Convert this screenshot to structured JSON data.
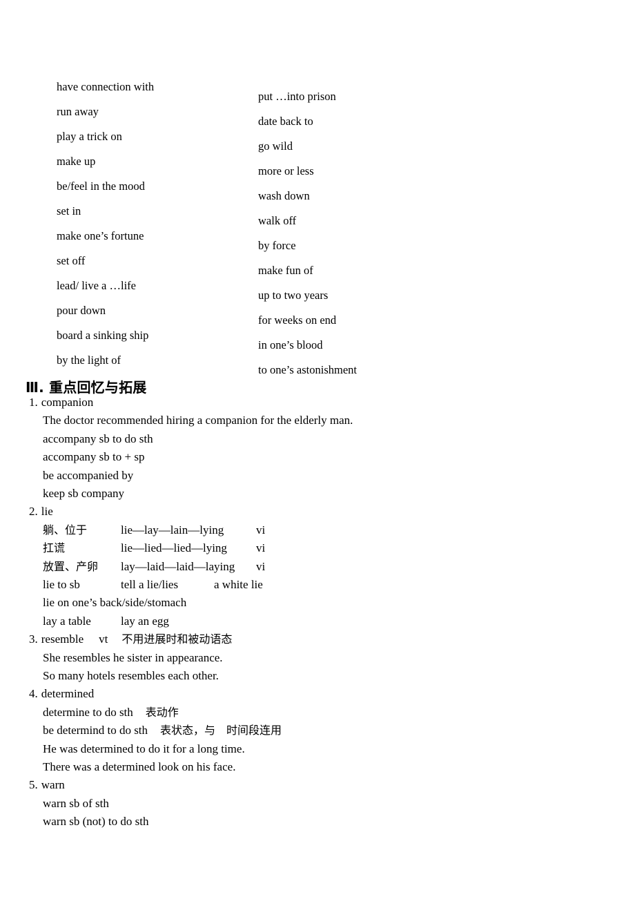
{
  "phrase_list": {
    "left_column": [
      "have connection with",
      "run away",
      "play a trick on",
      "make up",
      "be/feel in the mood",
      "set in",
      "make one’s fortune",
      "set off",
      "lead/ live a …life",
      "pour down",
      "board a sinking ship",
      "by the light of"
    ],
    "right_column": [
      "put …into prison",
      "date back to",
      "go wild",
      "more or less",
      "wash down",
      "walk off",
      "by force",
      "make fun of",
      "up to two years",
      "for weeks on end",
      "in one’s blood",
      "to one’s astonishment"
    ]
  },
  "section": {
    "heading": "Ⅲ. 重点回忆与拓展"
  },
  "entries": [
    {
      "num": "1.",
      "word": "companion",
      "pos": "",
      "cn_note": "",
      "lines": [
        "The doctor recommended hiring a companion for the elderly man.",
        "accompany sb to do sth",
        "accompany sb to + sp",
        "be accompanied by",
        "keep sb company"
      ]
    },
    {
      "num": "2.",
      "word": "lie",
      "pos": "",
      "cn_note": "",
      "conjugations": [
        {
          "cn": "躺、位于",
          "forms": "lie—lay—lain—lying",
          "pos": "vi"
        },
        {
          "cn": "扛谎",
          "forms": "lie—lied—lied—lying",
          "pos": "vi"
        },
        {
          "cn": "放置、产卵",
          "forms": "lay—laid—laid—laying",
          "pos": "vi"
        }
      ],
      "col_rows": [
        {
          "c1": "lie to sb",
          "c2": "tell a lie/lies",
          "c3": "a white lie"
        },
        {
          "c1": "lie on one’s back/side/stomach",
          "c2": "",
          "c3": ""
        },
        {
          "c1": "lay a table",
          "c2": "lay an egg",
          "c3": ""
        }
      ]
    },
    {
      "num": "3.",
      "word": "resemble",
      "pos": "vt",
      "cn_note": "不用进展时和被动语态",
      "lines": [
        "She resembles he sister in appearance.",
        "So many hotels resembles each other."
      ]
    },
    {
      "num": "4.",
      "word": "determined",
      "pos": "",
      "cn_note": "",
      "annotated_lines": [
        {
          "text": "determine to do sth",
          "cn": "表动作"
        },
        {
          "text": "be determind to do sth",
          "cn": "表状态，与　时间段连用"
        }
      ],
      "lines": [
        "He was determined to do it for a long time.",
        "There was a determined look on his face."
      ]
    },
    {
      "num": "5.",
      "word": "warn",
      "pos": "",
      "cn_note": "",
      "lines": [
        "warn sb of sth",
        "warn sb (not) to do sth"
      ]
    }
  ]
}
